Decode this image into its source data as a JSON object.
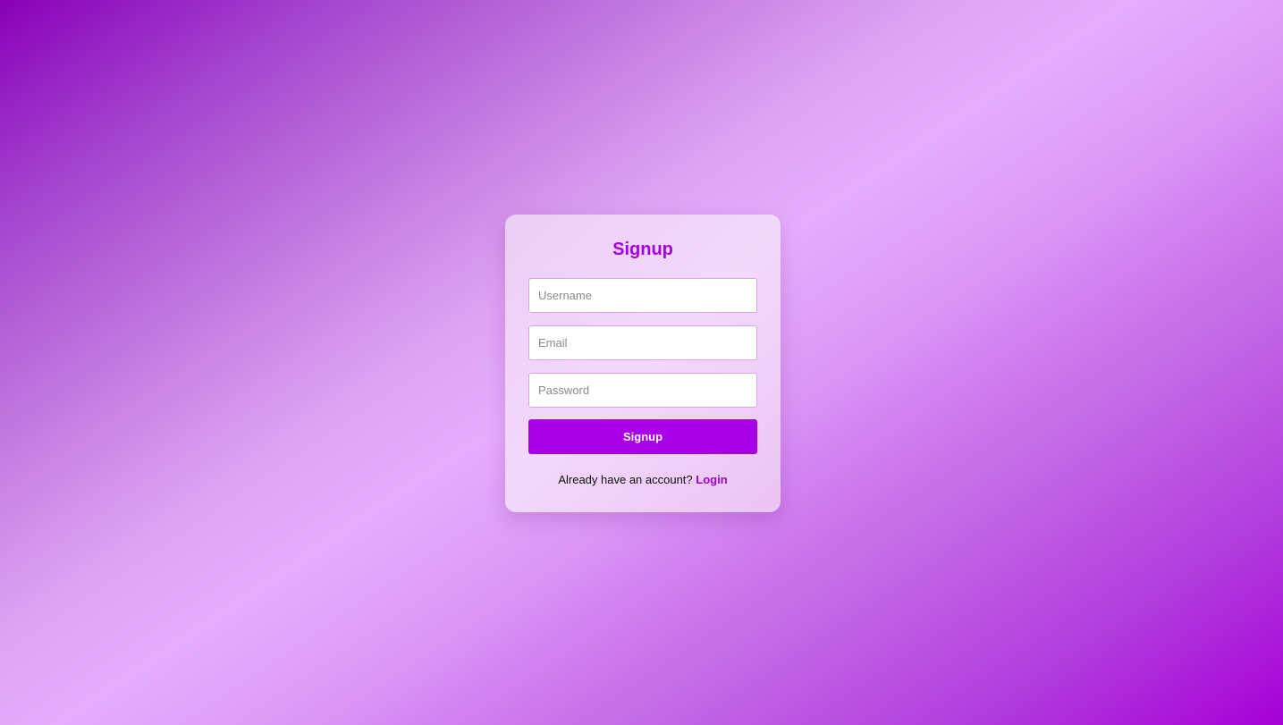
{
  "signup_form": {
    "title": "Signup",
    "username": {
      "placeholder": "Username",
      "value": ""
    },
    "email": {
      "placeholder": "Email",
      "value": ""
    },
    "password": {
      "placeholder": "Password",
      "value": ""
    },
    "submit_label": "Signup",
    "footer_text": "Already have an account?",
    "login_link_label": "Login"
  },
  "colors": {
    "accent": "#a700e8",
    "title": "#a300e0",
    "link": "#9a00cc"
  }
}
